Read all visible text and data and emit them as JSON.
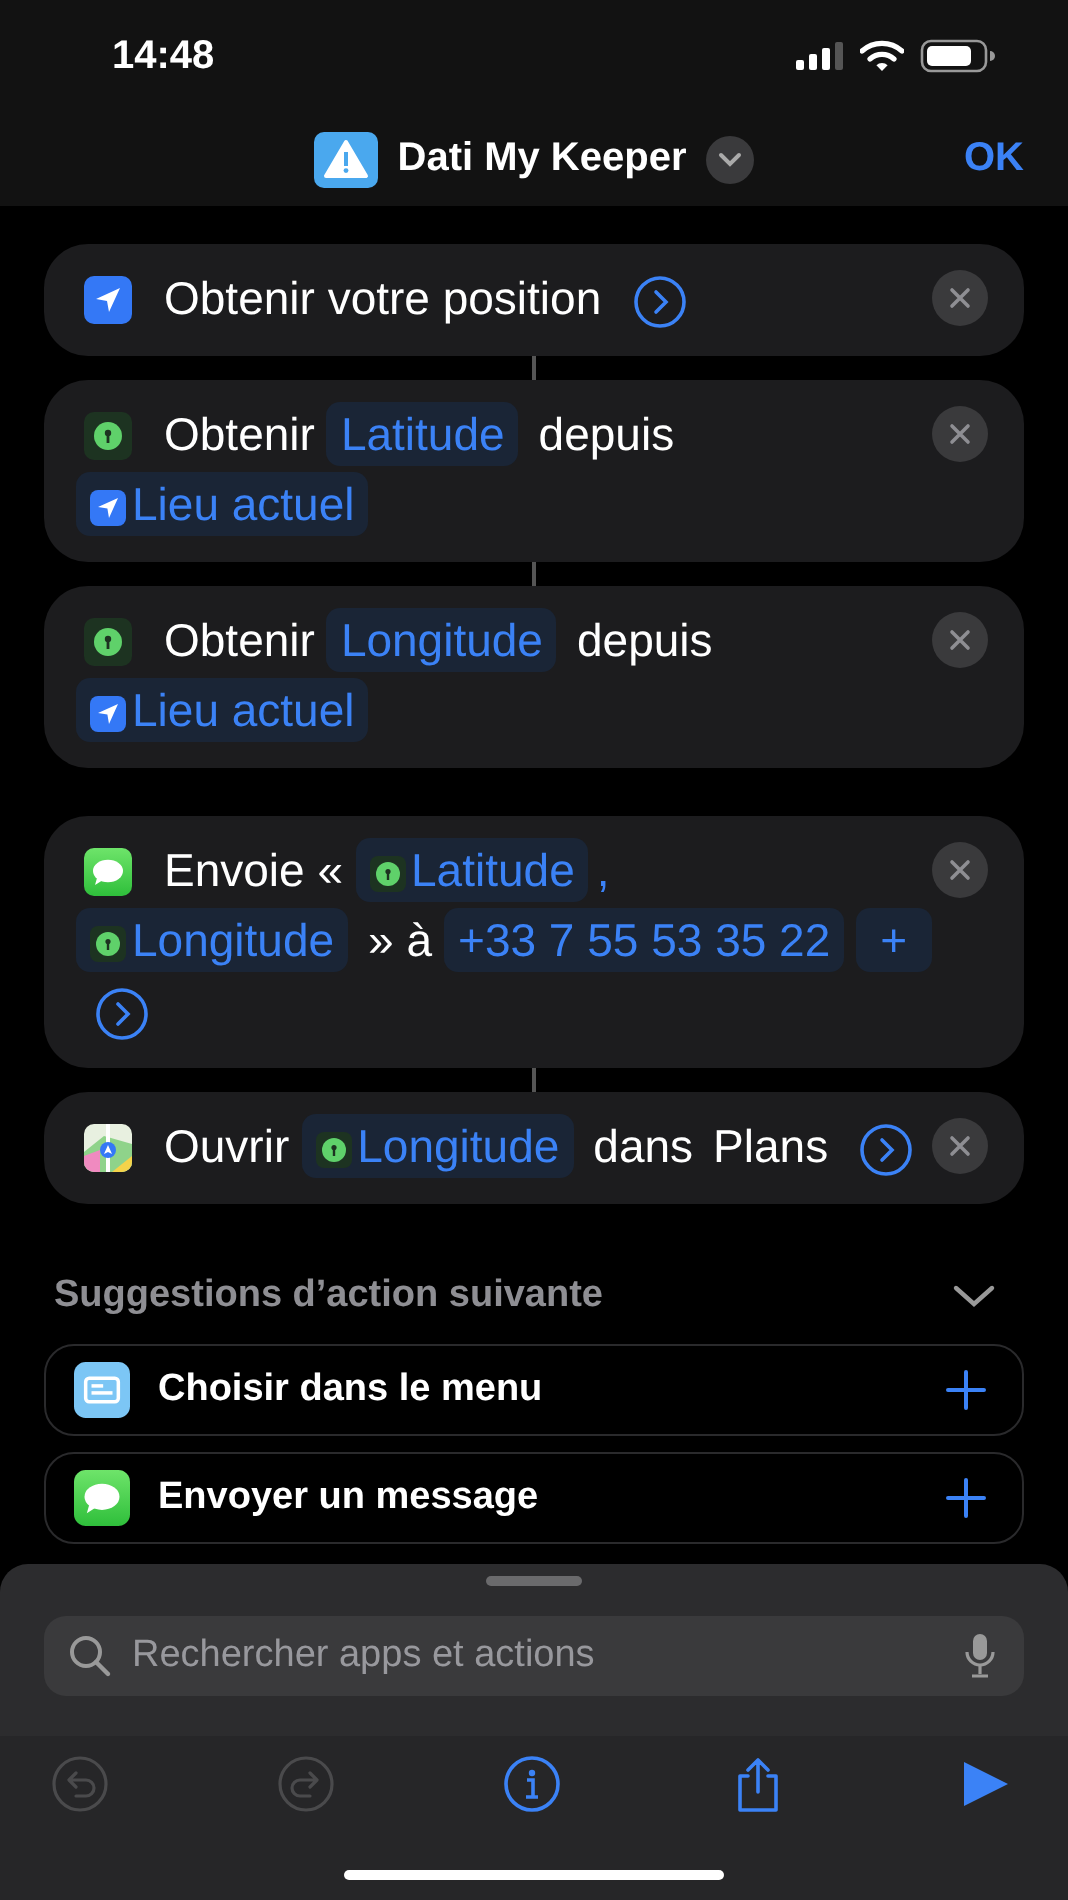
{
  "status_bar": {
    "time": "14:48"
  },
  "nav": {
    "title": "Dati My Keeper",
    "done": "OK"
  },
  "actions": [
    {
      "kind": "location",
      "linked": false,
      "parts": [
        {
          "kind": "text",
          "text": "Obtenir votre position"
        },
        {
          "kind": "more"
        }
      ]
    },
    {
      "kind": "variable",
      "linked": true,
      "parts": [
        {
          "kind": "text",
          "text": "Obtenir"
        },
        {
          "kind": "token",
          "text": "Latitude"
        },
        {
          "kind": "text",
          "text": "depuis"
        },
        {
          "kind": "location_token",
          "text": "Lieu actuel"
        }
      ]
    },
    {
      "kind": "variable",
      "linked": true,
      "parts": [
        {
          "kind": "text",
          "text": "Obtenir"
        },
        {
          "kind": "token",
          "text": "Longitude"
        },
        {
          "kind": "text",
          "text": "depuis"
        },
        {
          "kind": "location_token",
          "text": "Lieu actuel"
        }
      ]
    },
    {
      "kind": "messages",
      "linked": false,
      "parts": [
        {
          "kind": "text",
          "text": "Envoie «"
        },
        {
          "kind": "variable_token",
          "text": "Latitude"
        },
        {
          "kind": "punct",
          "text": ","
        },
        {
          "kind": "variable_token",
          "text": "Longitude"
        },
        {
          "kind": "text",
          "text": "» à"
        },
        {
          "kind": "token",
          "text": "+33 7 55 53 35 22"
        },
        {
          "kind": "add",
          "text": "+"
        },
        {
          "kind": "more"
        }
      ]
    },
    {
      "kind": "maps",
      "linked": true,
      "parts": [
        {
          "kind": "text",
          "text": "Ouvrir"
        },
        {
          "kind": "variable_token",
          "text": "Longitude"
        },
        {
          "kind": "text",
          "text": "dans"
        },
        {
          "kind": "text",
          "text": "Plans"
        },
        {
          "kind": "more"
        }
      ]
    }
  ],
  "suggestions": {
    "title": "Suggestions d’action suivante",
    "items": [
      {
        "kind": "menu",
        "label": "Choisir dans le menu"
      },
      {
        "kind": "messages",
        "label": "Envoyer un message"
      }
    ]
  },
  "search": {
    "placeholder": "Rechercher apps et actions"
  },
  "toolbar": [
    {
      "kind": "undo",
      "disabled": true
    },
    {
      "kind": "redo",
      "disabled": true
    },
    {
      "kind": "info",
      "disabled": false
    },
    {
      "kind": "share",
      "disabled": false
    },
    {
      "kind": "run",
      "disabled": false
    }
  ]
}
